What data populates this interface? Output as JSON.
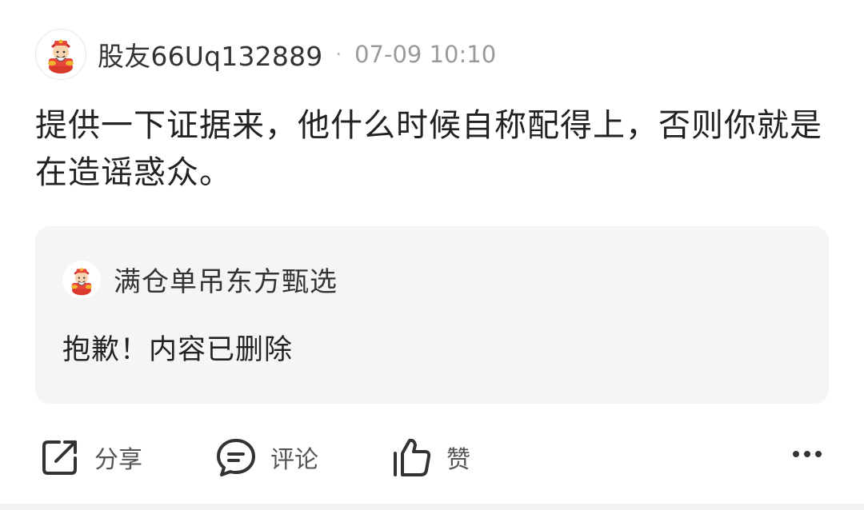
{
  "post": {
    "author": {
      "name": "股友66Uq132889",
      "avatar_icon": "fortune-god-avatar-icon"
    },
    "separator": "·",
    "timestamp": "07-09 10:10",
    "content": "提供一下证据来，他什么时候自称配得上，否则你就是在造谣惑众。"
  },
  "quoted": {
    "author": {
      "name": "满仓单吊东方甄选",
      "avatar_icon": "fortune-god-avatar-icon"
    },
    "content": "抱歉！内容已删除"
  },
  "actions": {
    "share": {
      "label": "分享",
      "icon": "share-icon"
    },
    "comment": {
      "label": "评论",
      "icon": "comment-icon"
    },
    "like": {
      "label": "赞",
      "icon": "thumbs-up-icon"
    },
    "more": {
      "icon": "more-dots-icon"
    }
  },
  "colors": {
    "quote_bg": "#f5f5f7",
    "text_primary": "#222222",
    "text_secondary": "#9a9a9a"
  }
}
